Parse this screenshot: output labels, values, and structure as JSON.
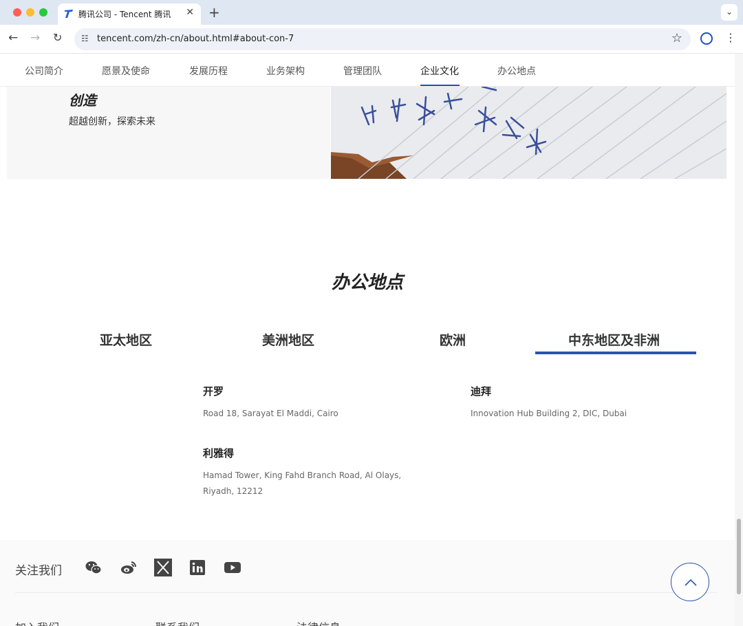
{
  "browser": {
    "tab_title": "腾讯公司 - Tencent 腾讯",
    "url": "tencent.com/zh-cn/about.html#about-con-7",
    "new_tab": "+",
    "close": "✕"
  },
  "subnav": {
    "items": [
      "公司简介",
      "愿景及使命",
      "发展历程",
      "业务架构",
      "管理团队",
      "企业文化",
      "办公地点"
    ],
    "active": "企业文化"
  },
  "culture": {
    "title": "创造",
    "desc": "超越创新，探索未来"
  },
  "offices": {
    "title": "办公地点",
    "tabs": [
      "亚太地区",
      "美洲地区",
      "欧洲",
      "中东地区及非洲"
    ],
    "active_tab": "中东地区及非洲",
    "cities": [
      {
        "name": "开罗",
        "address": "Road 18, Sarayat El Maddi, Cairo"
      },
      {
        "name": "迪拜",
        "address": "Innovation Hub Building 2, DIC, Dubai"
      },
      {
        "name": "利雅得",
        "address_line1": "Hamad Tower, King Fahd Branch Road, Al Olays,",
        "address_line2": "Riyadh, 12212"
      }
    ]
  },
  "footer": {
    "follow_label": "关注我们",
    "social_icons": [
      "wechat-icon",
      "weibo-icon",
      "x-icon",
      "linkedin-icon",
      "youtube-icon"
    ],
    "links": [
      "加入我们",
      "联系我们",
      "法律信息"
    ]
  },
  "colors": {
    "accent": "#2a53b0",
    "tabbar": "#dfe7f3"
  }
}
